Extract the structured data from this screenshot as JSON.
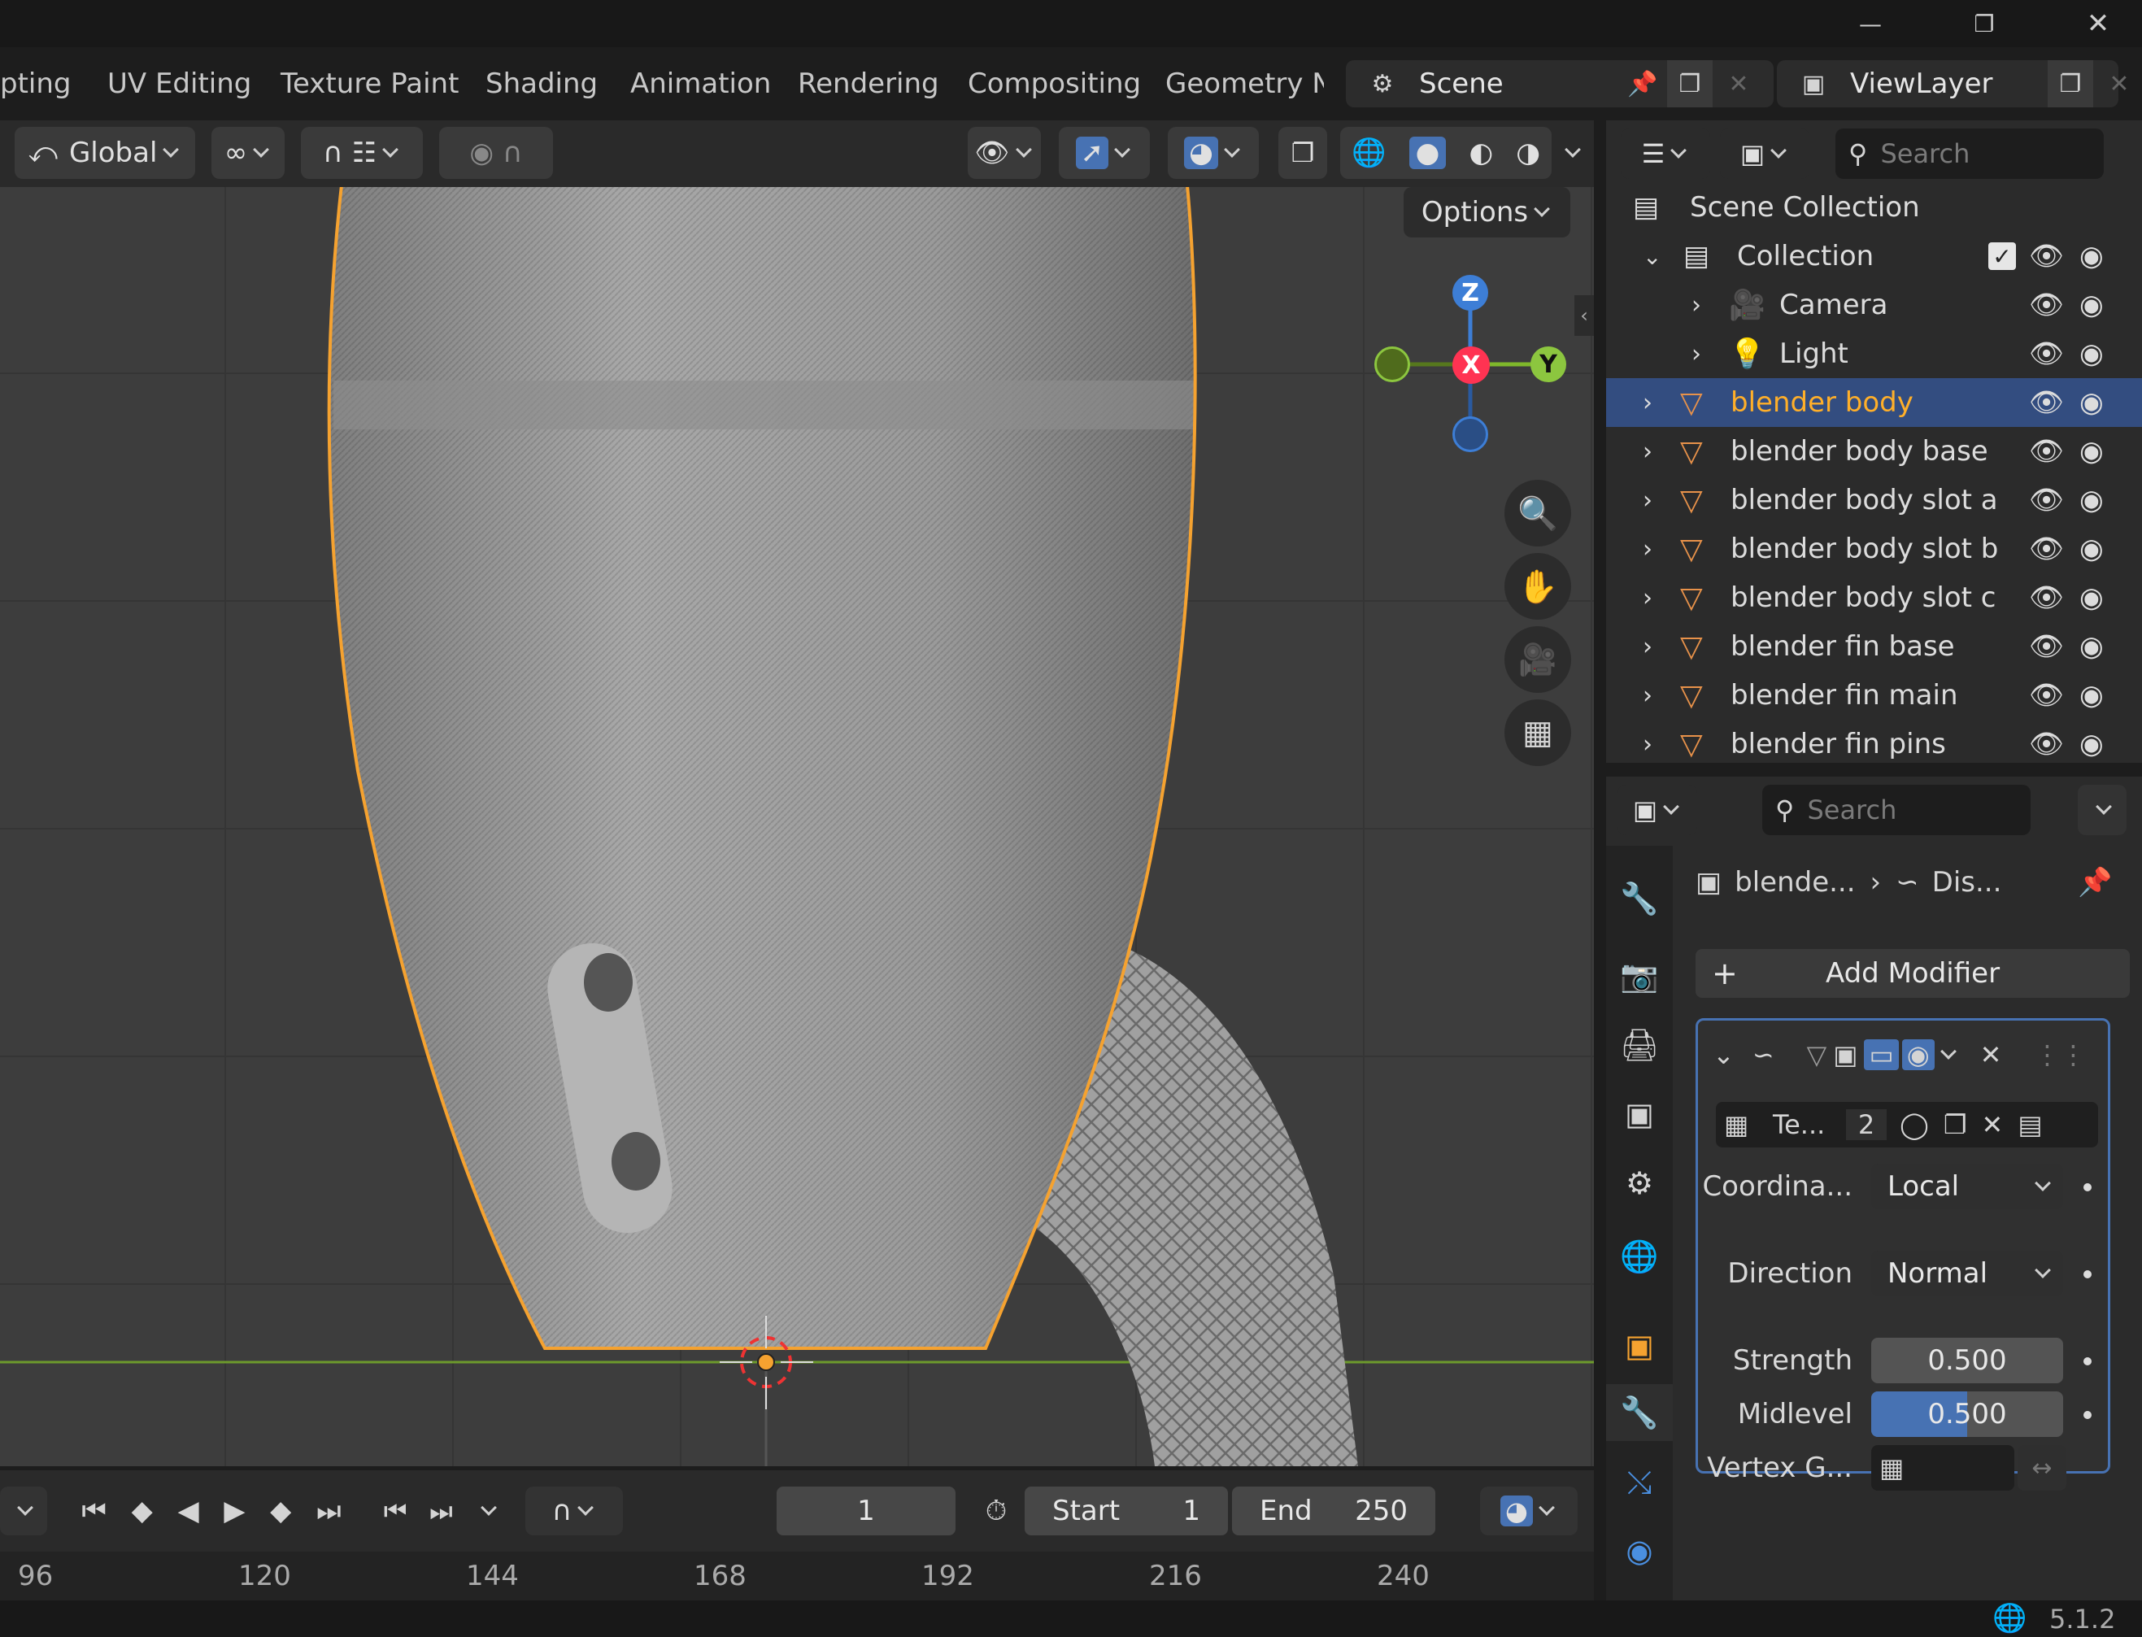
{
  "workspace_tabs": [
    "pting",
    "UV Editing",
    "Texture Paint",
    "Shading",
    "Animation",
    "Rendering",
    "Compositing",
    "Geometry No"
  ],
  "scene": {
    "name": "Scene"
  },
  "view_layer": {
    "name": "ViewLayer"
  },
  "viewport_header": {
    "transform_orientation": "Global",
    "options_label": "Options"
  },
  "gizmo": {
    "z": "Z",
    "x": "X",
    "y": "Y"
  },
  "outliner": {
    "search_placeholder": "Search",
    "scene_collection": "Scene Collection",
    "collection": "Collection",
    "items": [
      {
        "name": "Camera",
        "type": "camera",
        "selected": false
      },
      {
        "name": "Light",
        "type": "light",
        "selected": false
      },
      {
        "name": "blender body",
        "type": "mesh",
        "selected": true
      },
      {
        "name": "blender body base",
        "type": "mesh",
        "selected": false
      },
      {
        "name": "blender body slot a",
        "type": "mesh",
        "selected": false
      },
      {
        "name": "blender body slot b",
        "type": "mesh",
        "selected": false
      },
      {
        "name": "blender body slot c",
        "type": "mesh",
        "selected": false
      },
      {
        "name": "blender fin base",
        "type": "mesh",
        "selected": false
      },
      {
        "name": "blender fin main",
        "type": "mesh",
        "selected": false
      },
      {
        "name": "blender fin pins",
        "type": "mesh",
        "selected": false
      }
    ]
  },
  "properties": {
    "search_placeholder": "Search",
    "breadcrumb_object": "blende...",
    "breadcrumb_modifier": "Dis...",
    "add_modifier": "Add Modifier",
    "texture_name": "Te...",
    "texture_users": "2",
    "coordinates_label": "Coordina...",
    "coordinates_value": "Local",
    "direction_label": "Direction",
    "direction_value": "Normal",
    "strength_label": "Strength",
    "strength_value": "0.500",
    "midlevel_label": "Midlevel",
    "midlevel_value": "0.500",
    "midlevel_fill": 0.5,
    "vertex_group_label": "Vertex G..."
  },
  "timeline": {
    "current_frame": "1",
    "start_label": "Start",
    "start_value": "1",
    "end_label": "End",
    "end_value": "250",
    "ruler": [
      "96",
      "120",
      "144",
      "168",
      "192",
      "216",
      "240"
    ]
  },
  "status": {
    "version": "5.1.2"
  }
}
